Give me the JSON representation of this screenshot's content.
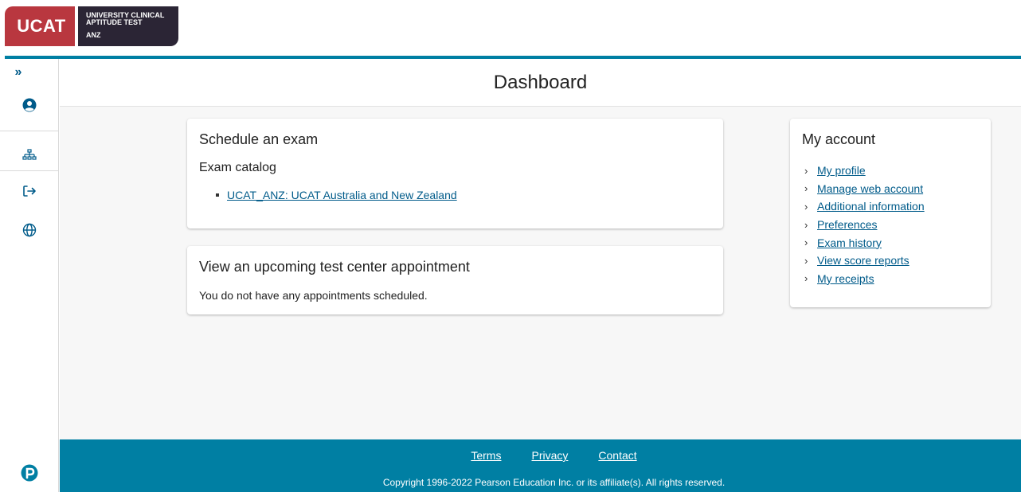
{
  "brand": {
    "logo_short": "UCAT",
    "logo_line1": "UNIVERSITY CLINICAL",
    "logo_line2": "APTITUDE TEST",
    "logo_region": "ANZ",
    "accent_color": "#007fa3",
    "logo_red": "#b9373f",
    "logo_dark": "#2b2535"
  },
  "sidebar": {
    "items": [
      {
        "icon": "double-chevron-right-icon",
        "glyph": "»"
      },
      {
        "icon": "user-circle-icon"
      },
      {
        "icon": "sitemap-icon"
      },
      {
        "icon": "sign-out-icon"
      },
      {
        "icon": "globe-icon"
      }
    ],
    "bottom_icon": "pearson-logo-icon"
  },
  "header": {
    "title": "Dashboard"
  },
  "schedule": {
    "title": "Schedule an exam",
    "catalog_label": "Exam catalog",
    "exams": [
      "UCAT_ANZ: UCAT Australia and New Zealand"
    ]
  },
  "appointments": {
    "title": "View an upcoming test center appointment",
    "empty_text": "You do not have any appointments scheduled."
  },
  "account": {
    "title": "My account",
    "links": [
      "My profile",
      "Manage web account",
      "Additional information",
      "Preferences",
      "Exam history",
      "View score reports",
      "My receipts"
    ]
  },
  "footer": {
    "links": [
      "Terms",
      "Privacy",
      "Contact"
    ],
    "copyright": "Copyright 1996-2022 Pearson Education Inc. or its affiliate(s). All rights reserved."
  }
}
